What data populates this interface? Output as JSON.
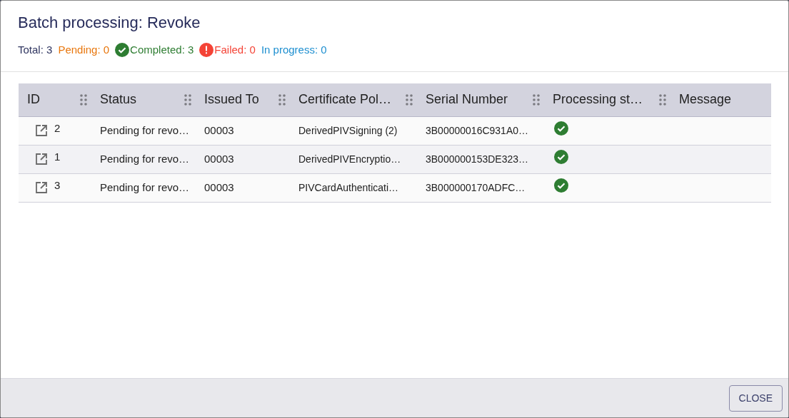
{
  "dialog": {
    "title": "Batch processing: Revoke"
  },
  "counts": [
    {
      "kind": "total",
      "label": "Total: 3"
    },
    {
      "kind": "pending",
      "label": "Pending: 0"
    },
    {
      "kind": "completed",
      "label": "Completed: 3"
    },
    {
      "kind": "failed",
      "label": "Failed: 0"
    },
    {
      "kind": "in_progress",
      "label": "In progress: 0"
    }
  ],
  "table": {
    "columns": [
      "ID",
      "Status",
      "Issued To",
      "Certificate Pol…",
      "Serial Number",
      "Processing st…",
      "Message"
    ],
    "rows": [
      {
        "id": "2",
        "status": "Pending for revo…",
        "issued_to": "00003",
        "certificate_policy": "DerivedPIVSigning (2)",
        "serial_number": "3B00000016C931A0…",
        "processing_status": {
          "kind": "success"
        }
      },
      {
        "id": "1",
        "status": "Pending for revo…",
        "issued_to": "00003",
        "certificate_policy": "DerivedPIVEncryptio…",
        "serial_number": "3B000000153DE323…",
        "processing_status": {
          "kind": "success"
        }
      },
      {
        "id": "3",
        "status": "Pending for revo…",
        "issued_to": "00003",
        "certificate_policy": "PIVCardAuthenticati…",
        "serial_number": "3B000000170ADFC…",
        "processing_status": {
          "kind": "success"
        }
      }
    ]
  },
  "footer": {
    "button": "CLOSE"
  }
}
